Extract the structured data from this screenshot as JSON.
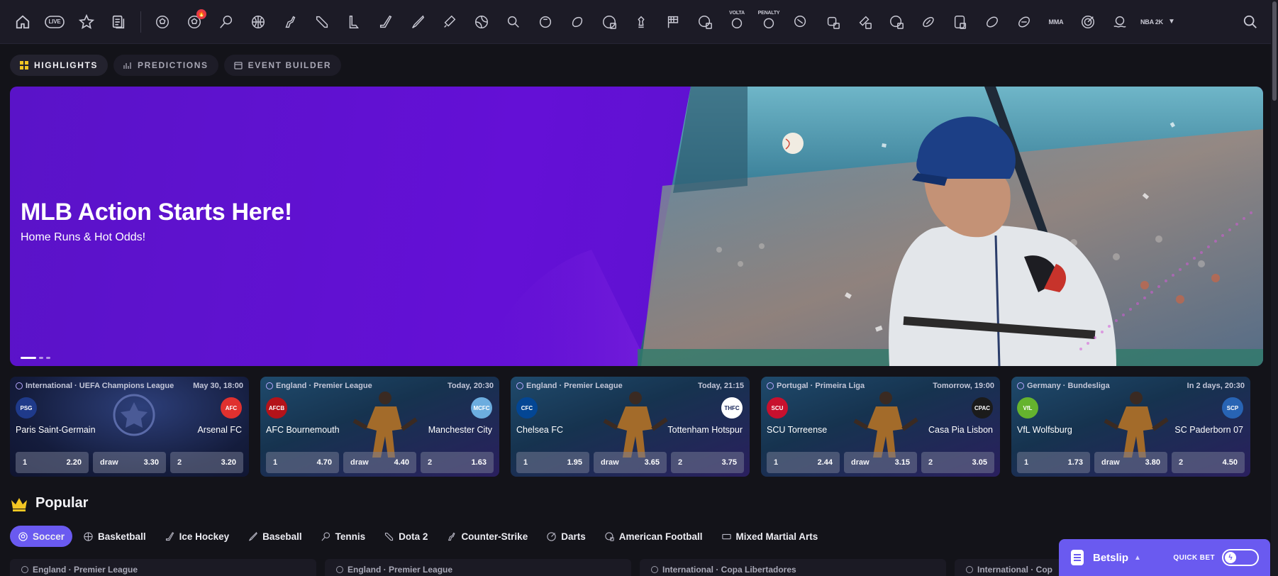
{
  "topbar": {
    "icons": [
      {
        "name": "home-icon"
      },
      {
        "name": "live-icon",
        "label": "LIVE"
      },
      {
        "name": "favorites-star-icon"
      },
      {
        "name": "betslip-history-icon"
      },
      {
        "name": "soccer-icon"
      },
      {
        "name": "soccer-hot-icon"
      },
      {
        "name": "tennis-icon"
      },
      {
        "name": "basketball-icon"
      },
      {
        "name": "counter-strike-icon"
      },
      {
        "name": "dota2-icon"
      },
      {
        "name": "league-of-legends-icon"
      },
      {
        "name": "ice-hockey-icon"
      },
      {
        "name": "baseball-icon"
      },
      {
        "name": "cricket-icon"
      },
      {
        "name": "volleyball-icon"
      },
      {
        "name": "table-tennis-icon"
      },
      {
        "name": "golf-icon"
      },
      {
        "name": "rugby-icon"
      },
      {
        "name": "esoccer-icon"
      },
      {
        "name": "chess-icon"
      },
      {
        "name": "motorsport-flag-icon"
      },
      {
        "name": "ebasketball-icon"
      },
      {
        "name": "volta-icon",
        "label": "VOLTA"
      },
      {
        "name": "penalty-icon",
        "label": "PENALTY"
      },
      {
        "name": "handball-icon"
      },
      {
        "name": "boxing-icon"
      },
      {
        "name": "ecricket-icon"
      },
      {
        "name": "efifa-icon"
      },
      {
        "name": "american-football-icon"
      },
      {
        "name": "ehockey-icon"
      },
      {
        "name": "aussie-rules-icon"
      },
      {
        "name": "rugby-league-icon"
      },
      {
        "name": "mma-icon",
        "label": "MMA"
      },
      {
        "name": "darts-icon"
      },
      {
        "name": "water-polo-icon"
      },
      {
        "name": "nba2k-icon",
        "label": "NBA 2K"
      }
    ]
  },
  "tabs": [
    {
      "label": "HIGHLIGHTS"
    },
    {
      "label": "PREDICTIONS"
    },
    {
      "label": "EVENT BUILDER"
    }
  ],
  "banner": {
    "title": "MLB Action Starts Here!",
    "subtitle": "Home Runs & Hot Odds!"
  },
  "cards": [
    {
      "competition": "International · UEFA Champions League",
      "time": "May 30, 18:00",
      "home": "Paris Saint-Germain",
      "away": "Arsenal FC",
      "home_abbr": "PSG",
      "away_abbr": "AFC",
      "odds": [
        {
          "k": "1",
          "v": "2.20"
        },
        {
          "k": "draw",
          "v": "3.30"
        },
        {
          "k": "2",
          "v": "3.20"
        }
      ]
    },
    {
      "competition": "England · Premier League",
      "time": "Today, 20:30",
      "home": "AFC Bournemouth",
      "away": "Manchester City",
      "home_abbr": "AFCB",
      "away_abbr": "MCFC",
      "odds": [
        {
          "k": "1",
          "v": "4.70"
        },
        {
          "k": "draw",
          "v": "4.40"
        },
        {
          "k": "2",
          "v": "1.63"
        }
      ]
    },
    {
      "competition": "England · Premier League",
      "time": "Today, 21:15",
      "home": "Chelsea FC",
      "away": "Tottenham Hotspur",
      "home_abbr": "CFC",
      "away_abbr": "THFC",
      "odds": [
        {
          "k": "1",
          "v": "1.95"
        },
        {
          "k": "draw",
          "v": "3.65"
        },
        {
          "k": "2",
          "v": "3.75"
        }
      ]
    },
    {
      "competition": "Portugal · Primeira Liga",
      "time": "Tomorrow, 19:00",
      "home": "SCU Torreense",
      "away": "Casa Pia Lisbon",
      "home_abbr": "SCU",
      "away_abbr": "CPAC",
      "odds": [
        {
          "k": "1",
          "v": "2.44"
        },
        {
          "k": "draw",
          "v": "3.15"
        },
        {
          "k": "2",
          "v": "3.05"
        }
      ]
    },
    {
      "competition": "Germany · Bundesliga",
      "time": "In 2 days, 20:30",
      "home": "VfL Wolfsburg",
      "away": "SC Paderborn 07",
      "home_abbr": "VfL",
      "away_abbr": "SCP",
      "odds": [
        {
          "k": "1",
          "v": "1.73"
        },
        {
          "k": "draw",
          "v": "3.80"
        },
        {
          "k": "2",
          "v": "4.50"
        }
      ]
    }
  ],
  "popular": {
    "title": "Popular",
    "chips": [
      {
        "label": "Soccer",
        "icon": "soccer-icon",
        "active": true
      },
      {
        "label": "Basketball",
        "icon": "basketball-icon"
      },
      {
        "label": "Ice Hockey",
        "icon": "ice-hockey-icon"
      },
      {
        "label": "Baseball",
        "icon": "baseball-icon"
      },
      {
        "label": "Tennis",
        "icon": "tennis-icon"
      },
      {
        "label": "Dota 2",
        "icon": "dota2-icon"
      },
      {
        "label": "Counter-Strike",
        "icon": "counter-strike-icon"
      },
      {
        "label": "Darts",
        "icon": "darts-icon"
      },
      {
        "label": "American Football",
        "icon": "american-football-icon"
      },
      {
        "label": "Mixed Martial Arts",
        "icon": "mma-icon"
      }
    ],
    "leagues": [
      {
        "label": "England · Premier League"
      },
      {
        "label": "England · Premier League"
      },
      {
        "label": "International · Copa Libertadores"
      },
      {
        "label": "International · Cop"
      }
    ]
  },
  "betslip": {
    "label": "Betslip",
    "quick_bet_label": "QUICK BET"
  },
  "colors": {
    "accent": "#6a5af0",
    "banner_purple": "#6410d6",
    "background": "#131319",
    "topbar": "#1c1b26"
  }
}
